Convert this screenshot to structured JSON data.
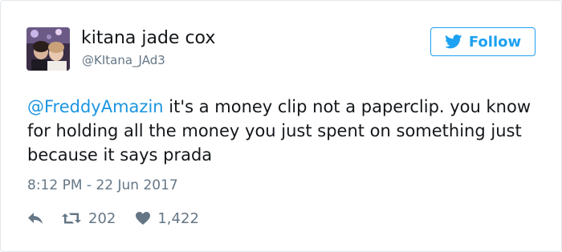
{
  "user": {
    "display_name": "kitana jade cox",
    "handle": "@KItana_JAd3",
    "avatar_icon": "profile-photo"
  },
  "follow_button": {
    "label": "Follow",
    "icon": "twitter-bird-icon",
    "color": "#1da1f2"
  },
  "tweet": {
    "mention": "@FreddyAmazin",
    "text": " it's a money clip not a paperclip. you know for holding all the money you just spent on something just because it says prada",
    "timestamp": "8:12 PM - 22 Jun 2017",
    "mention_color": "#1b95e0"
  },
  "actions": {
    "reply_icon": "reply-icon",
    "retweet_icon": "retweet-icon",
    "retweet_count": "202",
    "like_icon": "heart-icon",
    "like_count": "1,422"
  }
}
